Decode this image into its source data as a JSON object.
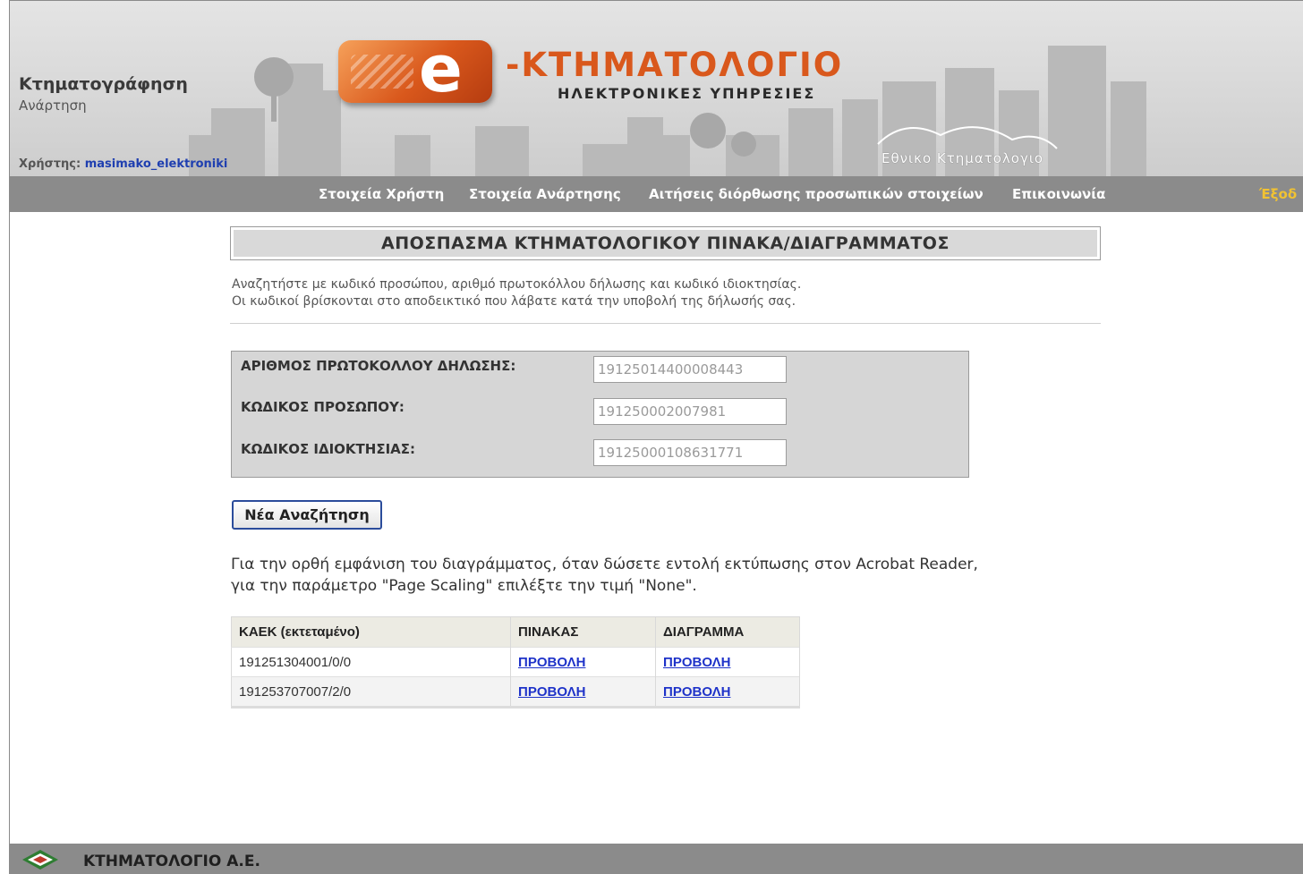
{
  "header": {
    "section_title": "Κτηματογράφηση",
    "section_subtitle": "Ανάρτηση",
    "user_label": "Χρήστης:",
    "username": "masimako_elektroniki",
    "logo_title": "-ΚΤΗΜΑΤΟΛΟΓΙΟ",
    "logo_letter": "e",
    "logo_subtitle": "ΗΛΕΚΤΡΟΝΙΚΕΣ ΥΠΗΡΕΣΙΕΣ",
    "agency_text": "Εθνικο Κτηματολογιο"
  },
  "nav": {
    "items": [
      {
        "label": "Στοιχεία Χρήστη"
      },
      {
        "label": "Στοιχεία Ανάρτησης"
      },
      {
        "label": "Αιτήσεις διόρθωσης προσωπικών στοιχείων"
      },
      {
        "label": "Επικοινωνία"
      }
    ],
    "exit_label": "Έξοδ"
  },
  "main": {
    "title": "ΑΠΟΣΠΑΣΜΑ ΚΤΗΜΑΤΟΛΟΓΙΚΟΥ ΠΙΝΑΚΑ/ΔΙΑΓΡΑΜΜΑΤΟΣ",
    "intro_line1": "Αναζητήστε με κωδικό προσώπου, αριθμό πρωτοκόλλου δήλωσης και κωδικό ιδιοκτησίας.",
    "intro_line2": "Οι κωδικοί βρίσκονται στο αποδεικτικό που λάβατε κατά την υποβολή της δήλωσής σας.",
    "form": {
      "protocol_label": "ΑΡΙΘΜΟΣ ΠΡΩΤΟΚΟΛΛΟΥ ΔΗΛΩΣΗΣ:",
      "protocol_value": "19125014400008443",
      "person_label": "ΚΩΔΙΚΟΣ ΠΡΟΣΩΠΟΥ:",
      "person_value": "191250002007981",
      "property_label": "ΚΩΔΙΚΟΣ ΙΔΙΟΚΤΗΣΙΑΣ:",
      "property_value": "19125000108631771"
    },
    "new_search_button": "Νέα Αναζήτηση",
    "note_line1": "Για την ορθή εμφάνιση του διαγράμματος, όταν δώσετε εντολή εκτύπωσης στον Acrobat Reader,",
    "note_line2": "για την παράμετρο \"Page Scaling\" επιλέξτε την τιμή \"None\".",
    "table": {
      "headers": [
        "ΚΑΕΚ (εκτεταμένο)",
        "ΠΙΝΑΚΑΣ",
        "ΔΙΑΓΡΑΜΜΑ"
      ],
      "rows": [
        {
          "kaek": "191251304001/0/0",
          "table_link": "ΠΡΟΒΟΛΗ",
          "diagram_link": "ΠΡΟΒΟΛΗ"
        },
        {
          "kaek": "191253707007/2/0",
          "table_link": "ΠΡΟΒΟΛΗ",
          "diagram_link": "ΠΡΟΒΟΛΗ"
        }
      ]
    }
  },
  "footer": {
    "company": "ΚΤΗΜΑΤΟΛΟΓΙΟ Α.Ε."
  },
  "colors": {
    "brand_orange": "#d9581c",
    "nav_gray": "#8b8b8b",
    "link_blue": "#1f33c9",
    "exit_yellow": "#f1c232"
  }
}
